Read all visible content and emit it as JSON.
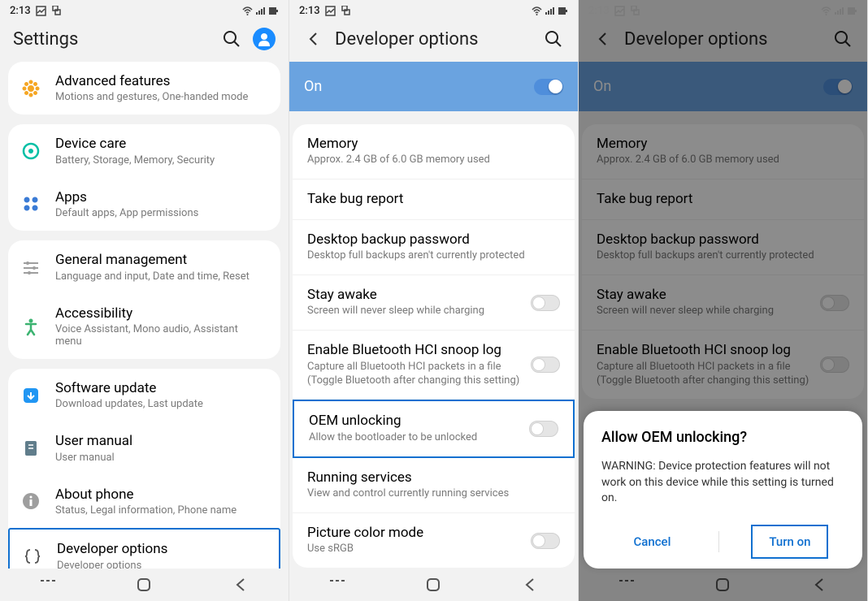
{
  "status": {
    "time": "2:13"
  },
  "screen1": {
    "title": "Settings",
    "rows": {
      "advanced": {
        "title": "Advanced features",
        "sub": "Motions and gestures, One-handed mode"
      },
      "devicecare": {
        "title": "Device care",
        "sub": "Battery, Storage, Memory, Security"
      },
      "apps": {
        "title": "Apps",
        "sub": "Default apps, App permissions"
      },
      "general": {
        "title": "General management",
        "sub": "Language and input, Date and time, Reset"
      },
      "accessibility": {
        "title": "Accessibility",
        "sub": "Voice Assistant, Mono audio, Assistant menu"
      },
      "software": {
        "title": "Software update",
        "sub": "Download updates, Last update"
      },
      "usermanual": {
        "title": "User manual",
        "sub": "User manual"
      },
      "about": {
        "title": "About phone",
        "sub": "Status, Legal information, Phone name"
      },
      "developer": {
        "title": "Developer options",
        "sub": "Developer options"
      }
    }
  },
  "screen2": {
    "title": "Developer options",
    "banner": "On",
    "rows": {
      "memory": {
        "title": "Memory",
        "sub": "Approx. 2.4 GB of 6.0 GB memory used"
      },
      "bugreport": {
        "title": "Take bug report"
      },
      "backuppw": {
        "title": "Desktop backup password",
        "sub": "Desktop full backups aren't currently protected"
      },
      "stayawake": {
        "title": "Stay awake",
        "sub": "Screen will never sleep while charging"
      },
      "bthci": {
        "title": "Enable Bluetooth HCI snoop log",
        "sub": "Capture all Bluetooth HCI packets in a file (Toggle Bluetooth after changing this setting)"
      },
      "oem": {
        "title": "OEM unlocking",
        "sub": "Allow the bootloader to be unlocked"
      },
      "running": {
        "title": "Running services",
        "sub": "View and control currently running services"
      },
      "picture": {
        "title": "Picture color mode",
        "sub": "Use sRGB"
      }
    }
  },
  "screen3": {
    "title": "Developer options",
    "banner": "On",
    "rows": {
      "memory": {
        "title": "Memory",
        "sub": "Approx. 2.4 GB of 6.0 GB memory used"
      },
      "bugreport": {
        "title": "Take bug report"
      },
      "backuppw": {
        "title": "Desktop backup password",
        "sub": "Desktop full backups aren't currently protected"
      },
      "stayawake": {
        "title": "Stay awake",
        "sub": "Screen will never sleep while charging"
      },
      "bthci": {
        "title": "Enable Bluetooth HCI snoop log",
        "sub": "Capture all Bluetooth HCI packets in a file (Toggle Bluetooth after changing this setting)"
      }
    },
    "dialog": {
      "title": "Allow OEM unlocking?",
      "body": "WARNING: Device protection features will not work on this device while this setting is turned on.",
      "cancel": "Cancel",
      "confirm": "Turn on"
    }
  }
}
